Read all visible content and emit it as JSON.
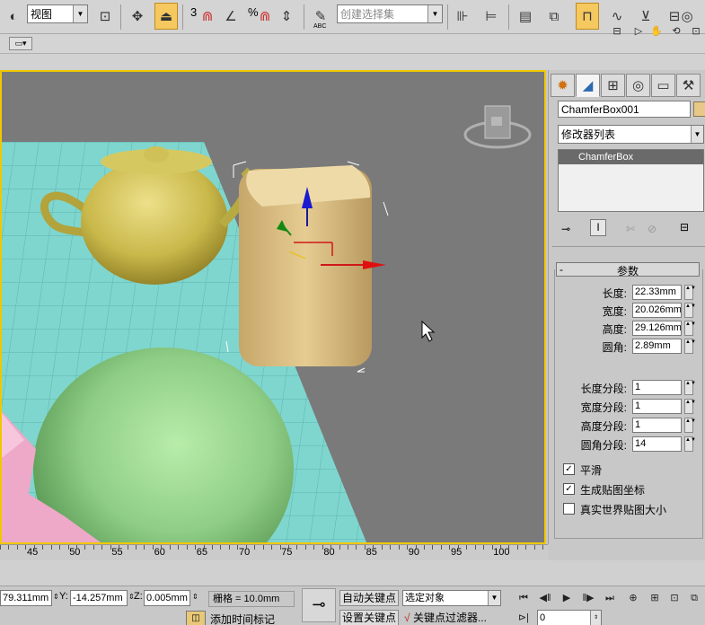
{
  "toolbar": {
    "view_combo": "视图",
    "selection_set_placeholder": "创建选择集",
    "snap_number": "3",
    "percent_symbol": "%",
    "abc_label": "ABC"
  },
  "command_panel": {
    "object_name": "ChamferBox001",
    "modifier_list": "修改器列表",
    "stack_item": "ChamferBox",
    "rollout_title": "参数",
    "rollout_collapse": "-",
    "params": [
      {
        "label": "长度:",
        "value": "22.33mm"
      },
      {
        "label": "宽度:",
        "value": "20.026mm"
      },
      {
        "label": "高度:",
        "value": "29.126mm"
      },
      {
        "label": "圆角:",
        "value": "2.89mm"
      }
    ],
    "segments": [
      {
        "label": "长度分段:",
        "value": "1"
      },
      {
        "label": "宽度分段:",
        "value": "1"
      },
      {
        "label": "高度分段:",
        "value": "1"
      },
      {
        "label": "圆角分段:",
        "value": "14"
      }
    ],
    "options": [
      {
        "label": "平滑",
        "checked": true,
        "mark": "✓"
      },
      {
        "label": "生成贴图坐标",
        "checked": true,
        "mark": "✓"
      },
      {
        "label": "真实世界贴图大小",
        "checked": false,
        "mark": ""
      }
    ]
  },
  "timeline": {
    "ticks": [
      "45",
      "50",
      "55",
      "60",
      "65",
      "70",
      "75",
      "80",
      "85",
      "90",
      "95",
      "100"
    ]
  },
  "status": {
    "x_value": "79.311mm",
    "y_label": "Y:",
    "y_value": "-14.257mm",
    "z_label": "Z:",
    "z_value": "0.005mm",
    "grid": "栅格 = 10.0mm",
    "auto_key": "自动关键点",
    "selected_object": "选定对象",
    "set_key": "设置关键点",
    "key_filters": "关键点过滤器...",
    "add_time_tag": "添加时间标记",
    "frame": "0"
  },
  "colors": {
    "active_viewport_border": "#f0c800",
    "grid_plane": "#7fd6cf",
    "teapot": "#c9b84a",
    "chamferbox": "#d9c088",
    "sphere": "#8fce86",
    "pink_object": "#eea8c8"
  }
}
